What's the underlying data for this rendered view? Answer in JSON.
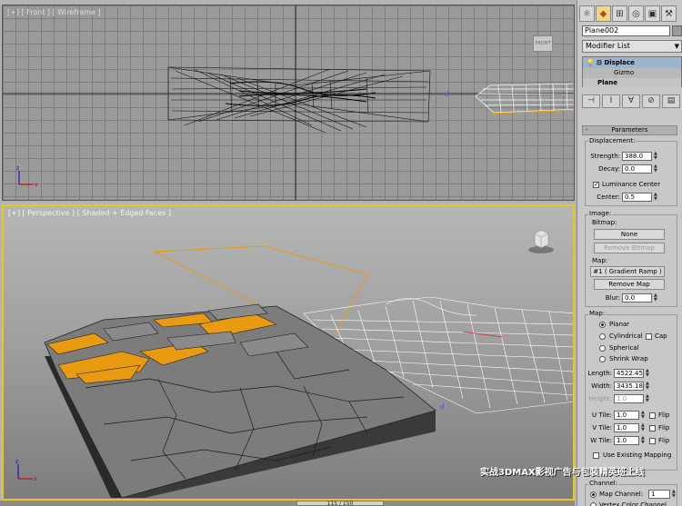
{
  "viewports": {
    "front": {
      "label": "[+] [ Front ] [ Wireframe ]",
      "cube_label": "FRONT"
    },
    "perspective": {
      "label": "[+] [ Perspective ] [ Shaded + Edged Faces ]"
    }
  },
  "timeline": {
    "frame_text": "115 / 150"
  },
  "watermark": "实战3DMAX影视广告与包装精英班上线",
  "panel": {
    "tabs": [
      "create",
      "modify",
      "hierarchy",
      "motion",
      "display",
      "utilities"
    ],
    "object_name": "Plane002",
    "modifier_list": "Modifier List",
    "stack": {
      "displace": "Displace",
      "gizmo": "Gizmo",
      "plane": "Plane"
    },
    "rollout_title": "Parameters",
    "displacement": {
      "group_label": "Displacement:",
      "strength_label": "Strength:",
      "strength": "388.0",
      "decay_label": "Decay:",
      "decay": "0.0",
      "luminance_center": "Luminance Center",
      "center_label": "Center:",
      "center": "0.5"
    },
    "image": {
      "group_label": "Image:",
      "bitmap_label": "Bitmap:",
      "none_button": "None",
      "remove_bitmap": "Remove Bitmap",
      "map_label": "Map:",
      "map_button": "#1 ( Gradient Ramp )",
      "remove_map": "Remove Map",
      "blur_label": "Blur:",
      "blur": "0.0"
    },
    "map": {
      "group_label": "Map:",
      "planar": "Planar",
      "cylindrical": "Cylindrical",
      "cap": "Cap",
      "spherical": "Spherical",
      "shrink_wrap": "Shrink Wrap",
      "length_label": "Length:",
      "length": "4522.45",
      "width_label": "Width:",
      "width": "3435.18",
      "height_label": "Height:",
      "height": "1.0",
      "utile_label": "U Tile:",
      "utile": "1.0",
      "vtile_label": "V Tile:",
      "vtile": "1.0",
      "wtile_label": "W Tile:",
      "wtile": "1.0",
      "flip": "Flip",
      "use_existing": "Use Existing Mapping"
    },
    "channel": {
      "group_label": "Channel:",
      "map_channel_label": "Map Channel:",
      "map_channel": "1",
      "vertex_color": "Vertex Color Channel"
    }
  },
  "colors": {
    "active_viewport_border": "#e8c818",
    "selected_modifier": "#9cb4cc",
    "orange_faces": "#e89a10"
  }
}
